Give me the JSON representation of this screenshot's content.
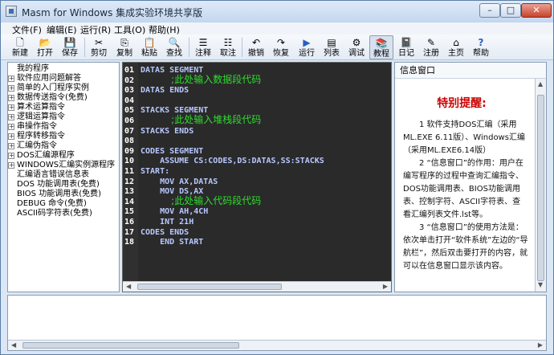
{
  "window": {
    "title": "Masm for Windows 集成实验环境共享版",
    "controls": {
      "minimize": "–",
      "maximize": "□",
      "close": "✕"
    }
  },
  "menu": [
    "文件(F)",
    "编辑(E)",
    "运行(R)",
    "工具(O)",
    "帮助(H)"
  ],
  "toolbar": [
    {
      "label": "新建",
      "icon": "new-file-icon",
      "glyph": "🗋"
    },
    {
      "label": "打开",
      "icon": "open-folder-icon",
      "glyph": "📂"
    },
    {
      "label": "保存",
      "icon": "save-icon",
      "glyph": "💾"
    },
    {
      "label": "剪切",
      "icon": "cut-icon",
      "glyph": "✂"
    },
    {
      "label": "复制",
      "icon": "copy-icon",
      "glyph": "⎘"
    },
    {
      "label": "粘贴",
      "icon": "paste-icon",
      "glyph": "📋"
    },
    {
      "label": "查找",
      "icon": "find-icon",
      "glyph": "🔍"
    },
    {
      "label": "注释",
      "icon": "comment-icon",
      "glyph": "☰"
    },
    {
      "label": "取注",
      "icon": "uncomment-icon",
      "glyph": "☷"
    },
    {
      "label": "撤销",
      "icon": "undo-icon",
      "glyph": "↶"
    },
    {
      "label": "恢复",
      "icon": "redo-icon",
      "glyph": "↷"
    },
    {
      "label": "运行",
      "icon": "run-icon",
      "glyph": "▶"
    },
    {
      "label": "列表",
      "icon": "list-icon",
      "glyph": "▤"
    },
    {
      "label": "调试",
      "icon": "debug-icon",
      "glyph": "⚙"
    },
    {
      "label": "教程",
      "icon": "tutorial-icon",
      "glyph": "📚"
    },
    {
      "label": "日记",
      "icon": "diary-icon",
      "glyph": "📓"
    },
    {
      "label": "注册",
      "icon": "register-icon",
      "glyph": "✎"
    },
    {
      "label": "主页",
      "icon": "home-icon",
      "glyph": "⌂"
    },
    {
      "label": "帮助",
      "icon": "help-icon",
      "glyph": "?"
    }
  ],
  "tree": [
    {
      "label": "我的程序",
      "expand": false
    },
    {
      "label": "软件应用问题解答",
      "expand": true
    },
    {
      "label": "简单的入门程序实例",
      "expand": true
    },
    {
      "label": "数据传送指令(免费)",
      "expand": true
    },
    {
      "label": "算术运算指令",
      "expand": true
    },
    {
      "label": "逻辑运算指令",
      "expand": true
    },
    {
      "label": "串操作指令",
      "expand": true
    },
    {
      "label": "程序转移指令",
      "expand": true
    },
    {
      "label": "汇编伪指令",
      "expand": true
    },
    {
      "label": "DOS汇编源程序",
      "expand": true
    },
    {
      "label": "WINDOWS汇编实例源程序",
      "expand": true
    },
    {
      "label": "汇编语言错误信息表",
      "expand": false
    },
    {
      "label": "DOS 功能调用表(免费)",
      "expand": false
    },
    {
      "label": "BIOS 功能调用表(免费)",
      "expand": false
    },
    {
      "label": "DEBUG 命令(免费)",
      "expand": false
    },
    {
      "label": "ASCII码字符表(免费)",
      "expand": false
    }
  ],
  "code": [
    {
      "no": "01",
      "text": "DATAS SEGMENT",
      "type": "kw"
    },
    {
      "no": "02",
      "text": "          ;此处输入数据段代码",
      "type": "cm"
    },
    {
      "no": "03",
      "text": "DATAS ENDS",
      "type": "kw"
    },
    {
      "no": "04",
      "text": "",
      "type": "kw"
    },
    {
      "no": "05",
      "text": "STACKS SEGMENT",
      "type": "kw"
    },
    {
      "no": "06",
      "text": "          ;此处输入堆栈段代码",
      "type": "cm"
    },
    {
      "no": "07",
      "text": "STACKS ENDS",
      "type": "kw"
    },
    {
      "no": "08",
      "text": "",
      "type": "kw"
    },
    {
      "no": "09",
      "text": "CODES SEGMENT",
      "type": "kw"
    },
    {
      "no": "10",
      "text": "    ASSUME CS:CODES,DS:DATAS,SS:STACKS",
      "type": "kw"
    },
    {
      "no": "11",
      "text": "START:",
      "type": "kw"
    },
    {
      "no": "12",
      "text": "    MOV AX,DATAS",
      "type": "kw"
    },
    {
      "no": "13",
      "text": "    MOV DS,AX",
      "type": "kw"
    },
    {
      "no": "14",
      "text": "          ;此处输入代码段代码",
      "type": "cm"
    },
    {
      "no": "15",
      "text": "    MOV AH,4CH",
      "type": "kw"
    },
    {
      "no": "16",
      "text": "    INT 21H",
      "type": "kw"
    },
    {
      "no": "17",
      "text": "CODES ENDS",
      "type": "kw"
    },
    {
      "no": "18",
      "text": "    END START",
      "type": "kw"
    }
  ],
  "info": {
    "header": "信息窗口",
    "title": "特别提醒:",
    "paragraphs": [
      "1 软件支持DOS汇编（采用ML.EXE 6.11版）、Windows汇编（采用ML.EXE6.14版）",
      "2 “信息窗口”的作用：用户在编写程序的过程中查询汇编指令、DOS功能调用表、BIOS功能调用表、控制字符、ASCII字符表、查看汇编列表文件.lst等。",
      "3 “信息窗口”的使用方法是：依次单击打开“软件系统”左边的“导航栏”，然后双击要打开的内容，就可以在信息窗口显示该内容。"
    ]
  }
}
